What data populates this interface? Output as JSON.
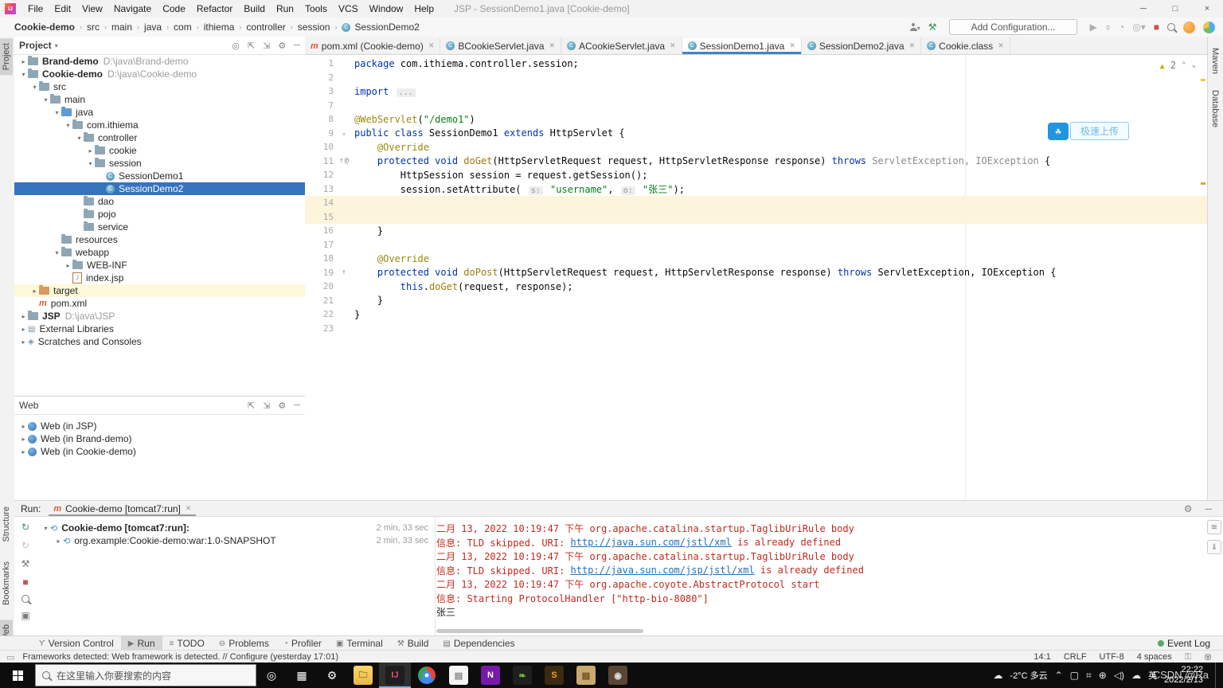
{
  "window": {
    "title": "JSP - SessionDemo1.java [Cookie-demo]",
    "menus": [
      "File",
      "Edit",
      "View",
      "Navigate",
      "Code",
      "Refactor",
      "Build",
      "Run",
      "Tools",
      "VCS",
      "Window",
      "Help"
    ],
    "controls": [
      "minimize",
      "maximize",
      "close"
    ]
  },
  "navbar": {
    "breadcrumbs": [
      "Cookie-demo",
      "src",
      "main",
      "java",
      "com",
      "ithiema",
      "controller",
      "session",
      "SessionDemo2"
    ],
    "add_configuration": "Add Configuration..."
  },
  "editor_tabs": [
    {
      "label": "pom.xml (Cookie-demo)",
      "icon": "maven",
      "active": false
    },
    {
      "label": "BCookieServlet.java",
      "icon": "class",
      "active": false
    },
    {
      "label": "ACookieServlet.java",
      "icon": "class",
      "active": false
    },
    {
      "label": "SessionDemo1.java",
      "icon": "class",
      "active": true
    },
    {
      "label": "SessionDemo2.java",
      "icon": "class",
      "active": false
    },
    {
      "label": "Cookie.class",
      "icon": "class",
      "active": false
    }
  ],
  "project_panel": {
    "title": "Project",
    "tree": [
      {
        "depth": 0,
        "chev": "▸",
        "icon": "folder",
        "label": "Brand-demo",
        "bold": true,
        "suffix": "D:\\java\\Brand-demo"
      },
      {
        "depth": 0,
        "chev": "▾",
        "icon": "folder",
        "label": "Cookie-demo",
        "bold": true,
        "suffix": "D:\\java\\Cookie-demo"
      },
      {
        "depth": 1,
        "chev": "▾",
        "icon": "folder",
        "label": "src"
      },
      {
        "depth": 2,
        "chev": "▾",
        "icon": "folder",
        "label": "main"
      },
      {
        "depth": 3,
        "chev": "▾",
        "icon": "folder-blue",
        "label": "java"
      },
      {
        "depth": 4,
        "chev": "▾",
        "icon": "folder",
        "label": "com.ithiema"
      },
      {
        "depth": 5,
        "chev": "▾",
        "icon": "folder",
        "label": "controller"
      },
      {
        "depth": 6,
        "chev": "▸",
        "icon": "folder",
        "label": "cookie"
      },
      {
        "depth": 6,
        "chev": "▾",
        "icon": "folder",
        "label": "session"
      },
      {
        "depth": 7,
        "chev": "",
        "icon": "class",
        "label": "SessionDemo1"
      },
      {
        "depth": 7,
        "chev": "",
        "icon": "class",
        "label": "SessionDemo2",
        "selected": true
      },
      {
        "depth": 5,
        "chev": "",
        "icon": "folder",
        "label": "dao"
      },
      {
        "depth": 5,
        "chev": "",
        "icon": "folder",
        "label": "pojo"
      },
      {
        "depth": 5,
        "chev": "",
        "icon": "folder",
        "label": "service"
      },
      {
        "depth": 3,
        "chev": "",
        "icon": "folder",
        "label": "resources"
      },
      {
        "depth": 3,
        "chev": "▾",
        "icon": "folder",
        "label": "webapp"
      },
      {
        "depth": 4,
        "chev": "▸",
        "icon": "folder",
        "label": "WEB-INF"
      },
      {
        "depth": 4,
        "chev": "",
        "icon": "jsp",
        "label": "index.jsp"
      },
      {
        "depth": 1,
        "chev": "▸",
        "icon": "folder-orange",
        "label": "target",
        "highlight": true
      },
      {
        "depth": 1,
        "chev": "",
        "icon": "maven",
        "label": "pom.xml"
      },
      {
        "depth": 0,
        "chev": "▸",
        "icon": "folder",
        "label": "JSP",
        "bold": true,
        "suffix": "D:\\java\\JSP"
      },
      {
        "depth": 0,
        "chev": "▸",
        "icon": "lib",
        "label": "External Libraries"
      },
      {
        "depth": 0,
        "chev": "▸",
        "icon": "scratch",
        "label": "Scratches and Consoles"
      }
    ]
  },
  "web_panel": {
    "title": "Web",
    "items": [
      "Web (in JSP)",
      "Web (in Brand-demo)",
      "Web (in Cookie-demo)"
    ]
  },
  "editor": {
    "warning_count": "2",
    "upload_widget_label": "极速上传",
    "lines": [
      {
        "n": "1",
        "g": [],
        "s": [
          [
            "k",
            "package"
          ],
          [
            "p",
            " com.ithiema.controller.session;"
          ]
        ]
      },
      {
        "n": "2",
        "g": [],
        "s": []
      },
      {
        "n": "3",
        "g": [],
        "s": [
          [
            "k",
            "import"
          ],
          [
            "p",
            " "
          ],
          [
            "f",
            "..."
          ]
        ]
      },
      {
        "n": "7",
        "g": [],
        "s": []
      },
      {
        "n": "8",
        "g": [],
        "s": [
          [
            "a",
            "@WebServlet"
          ],
          [
            "p",
            "("
          ],
          [
            "s",
            "\"/demo1\""
          ],
          [
            "p",
            ")"
          ]
        ]
      },
      {
        "n": "9",
        "g": [
          "⌄"
        ],
        "s": [
          [
            "k",
            "public class"
          ],
          [
            "p",
            " SessionDemo1 "
          ],
          [
            "k",
            "extends"
          ],
          [
            "p",
            " HttpServlet {"
          ]
        ]
      },
      {
        "n": "10",
        "g": [],
        "s": [
          [
            "a",
            "    @Override"
          ]
        ]
      },
      {
        "n": "11",
        "g": [
          "↑",
          "@"
        ],
        "s": [
          [
            "k",
            "    protected void"
          ],
          [
            "m",
            " doGet"
          ],
          [
            "p",
            "(HttpServletRequest request, HttpServletResponse response) "
          ],
          [
            "k",
            "throws"
          ],
          [
            "g",
            " ServletException, IOException"
          ],
          [
            "p",
            " {"
          ]
        ]
      },
      {
        "n": "12",
        "g": [],
        "s": [
          [
            "p",
            "        HttpSession session = request.getSession();"
          ]
        ]
      },
      {
        "n": "13",
        "g": [],
        "s": [
          [
            "p",
            "        session.setAttribute( "
          ],
          [
            "h",
            "s:"
          ],
          [
            "s",
            " \"username\""
          ],
          [
            "p",
            ", "
          ],
          [
            "h",
            "o:"
          ],
          [
            "s",
            " \"张三\""
          ],
          [
            "p",
            ");"
          ]
        ]
      },
      {
        "n": "14",
        "hl": true,
        "g": [],
        "s": []
      },
      {
        "n": "15",
        "hl": true,
        "g": [],
        "s": []
      },
      {
        "n": "16",
        "g": [],
        "s": [
          [
            "p",
            "    }"
          ]
        ]
      },
      {
        "n": "17",
        "g": [],
        "s": []
      },
      {
        "n": "18",
        "g": [],
        "s": [
          [
            "a",
            "    @Override"
          ]
        ]
      },
      {
        "n": "19",
        "g": [
          "↑"
        ],
        "s": [
          [
            "k",
            "    protected void"
          ],
          [
            "m",
            " doPost"
          ],
          [
            "p",
            "(HttpServletRequest request, HttpServletResponse response) "
          ],
          [
            "k",
            "throws"
          ],
          [
            "p",
            " ServletException, IOException {"
          ]
        ]
      },
      {
        "n": "20",
        "g": [],
        "s": [
          [
            "p",
            "        "
          ],
          [
            "k",
            "this"
          ],
          [
            "p",
            "."
          ],
          [
            "m",
            "doGet"
          ],
          [
            "p",
            "(request, response);"
          ]
        ]
      },
      {
        "n": "21",
        "g": [],
        "s": [
          [
            "p",
            "    }"
          ]
        ]
      },
      {
        "n": "22",
        "g": [],
        "s": [
          [
            "p",
            "}"
          ]
        ]
      },
      {
        "n": "23",
        "g": [],
        "s": []
      }
    ]
  },
  "right_stripe": [
    "Maven",
    "Database"
  ],
  "left_stripe": {
    "top": "Project",
    "bottom": [
      "Structure",
      "Bookmarks",
      "Web"
    ]
  },
  "run_panel": {
    "label": "Run:",
    "tab": "Cookie-demo [tomcat7:run]",
    "tree": [
      {
        "chev": "▾",
        "label": "Cookie-demo [tomcat7:run]:",
        "bold": true,
        "duration": "2 min, 33 sec"
      },
      {
        "chev": "▸",
        "label": "org.example:Cookie-demo:war:1.0-SNAPSHOT",
        "bold": false,
        "duration": "2 min, 33 sec",
        "indent": true
      }
    ],
    "console": [
      [
        [
          "err",
          "二月 13, 2022 10:19:47 下午 org.apache.catalina.startup.TaglibUriRule body"
        ]
      ],
      [
        [
          "err",
          "信息: TLD skipped. URI: "
        ],
        [
          "link",
          "http://java.sun.com/jstl/xml"
        ],
        [
          "err",
          " is already defined"
        ]
      ],
      [
        [
          "err",
          "二月 13, 2022 10:19:47 下午 org.apache.catalina.startup.TaglibUriRule body"
        ]
      ],
      [
        [
          "err",
          "信息: TLD skipped. URI: "
        ],
        [
          "link",
          "http://java.sun.com/jsp/jstl/xml"
        ],
        [
          "err",
          " is already defined"
        ]
      ],
      [
        [
          "err",
          "二月 13, 2022 10:19:47 下午 org.apache.coyote.AbstractProtocol start"
        ]
      ],
      [
        [
          "err",
          "信息: Starting ProtocolHandler [\"http-bio-8080\"]"
        ]
      ],
      [
        [
          "plain",
          "张三"
        ]
      ]
    ]
  },
  "bottom_bar": {
    "items": [
      {
        "label": "Version Control",
        "ico": "ϒ"
      },
      {
        "label": "Run",
        "ico": "▶",
        "active": true
      },
      {
        "label": "TODO",
        "ico": "≡"
      },
      {
        "label": "Problems",
        "ico": "⊖"
      },
      {
        "label": "Profiler",
        "ico": "◔"
      },
      {
        "label": "Terminal",
        "ico": "▣"
      },
      {
        "label": "Build",
        "ico": "⚒"
      },
      {
        "label": "Dependencies",
        "ico": "▤"
      }
    ],
    "event_log": "Event Log"
  },
  "status_bar": {
    "message": "Frameworks detected: Web framework is detected. // Configure (yesterday 17:01)",
    "caret": "14:1",
    "line_sep": "CRLF",
    "encoding": "UTF-8",
    "indent": "4 spaces"
  },
  "taskbar": {
    "search_placeholder": "在这里输入你要搜索的内容",
    "weather": "-2°C 多云",
    "ime": "英",
    "time": "22:22",
    "date": "2022/2/13",
    "watermark": "CSDN @Ra"
  }
}
